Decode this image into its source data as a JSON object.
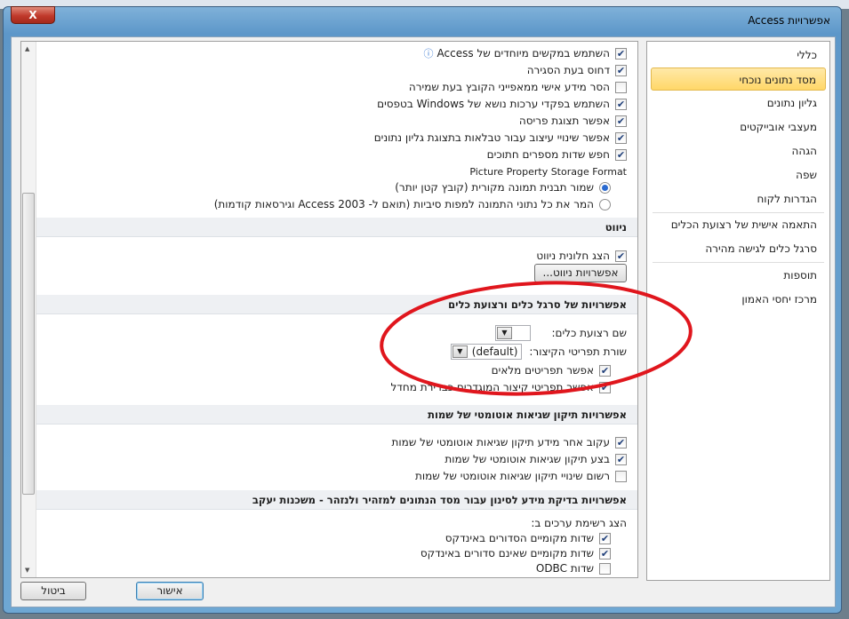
{
  "window": {
    "title": "אפשרויות Access",
    "close_label": "X"
  },
  "sidebar": {
    "items": [
      {
        "label": "כללי"
      },
      {
        "label": "מסד נתונים נוכחי"
      },
      {
        "label": "גליון נתונים"
      },
      {
        "label": "מעצבי אובייקטים"
      },
      {
        "label": "הגהה"
      },
      {
        "label": "שפה"
      },
      {
        "label": "הגדרות לקוח"
      },
      {
        "label": "התאמה אישית של רצועת הכלים"
      },
      {
        "label": "סרגל כלים לגישה מהירה"
      },
      {
        "label": "תוספות"
      },
      {
        "label": "מרכז יחסי האמון"
      }
    ],
    "selected": "מסד נתונים נוכחי"
  },
  "app_options": {
    "items": [
      {
        "label": "השתמש במקשים מיוחדים של Access",
        "checked": true
      },
      {
        "label": "דחוס בעת הסגירה",
        "checked": true
      },
      {
        "label": "הסר מידע אישי ממאפייני הקובץ בעת שמירה",
        "checked": false
      },
      {
        "label": "השתמש בפקדי ערכות נושא של Windows בטפסים",
        "checked": true
      },
      {
        "label": "אפשר תצוגת פריסה",
        "checked": true
      },
      {
        "label": "אפשר שינויי עיצוב עבור טבלאות בתצוגת גליון נתונים",
        "checked": true
      },
      {
        "label": "חפש שדות מספרים חתוכים",
        "checked": true
      }
    ],
    "picture_format_label": "Picture Property Storage Format",
    "radios": [
      {
        "label": "שמור תבנית תמונה מקורית (קובץ קטן יותר)",
        "selected": true
      },
      {
        "label": "המר את כל נתוני התמונה למפות סיביות (תואם ל- Access 2003 וגירסאות קודמות)",
        "selected": false
      }
    ]
  },
  "navigation": {
    "header": "ניווט",
    "show_pane": {
      "label": "הצג חלונית ניווט",
      "checked": true
    },
    "options_button": "אפשרויות ניווט..."
  },
  "ribbon": {
    "header": "אפשרויות של סרגל כלים ורצועת כלים",
    "ribbon_name_label": "שם רצועת כלים:",
    "ribbon_name_value": "",
    "shortcut_label": "שורת תפריטי הקיצור:",
    "shortcut_value": "(default)",
    "items": [
      {
        "label": "אפשר תפריטים מלאים",
        "checked": true
      },
      {
        "label": "אפשר תפריטי קיצור המוגדרים כברירת מחדל",
        "checked": true
      }
    ]
  },
  "autocorrect": {
    "header": "אפשרויות תיקון שגיאות אוטומטי של שמות",
    "items": [
      {
        "label": "עקוב אחר מידע תיקון שגיאות אוטומטי של שמות",
        "checked": true
      },
      {
        "label": "בצע תיקון שגיאות אוטומטי של שמות",
        "checked": true
      },
      {
        "label": "רשום שינויי תיקון שגיאות אוטומטי של שמות",
        "checked": false
      }
    ]
  },
  "filter": {
    "header": "אפשרויות בדיקת מידע לסינון עבור מסד הנתונים למזהיר ולנזהר - משכנות יעקב",
    "show_list_label": "הצג רשימת ערכים ב:",
    "items": [
      {
        "label": "שדות מקומיים הסדורים באינדקס",
        "checked": true
      },
      {
        "label": "שדות מקומיים שאינם סדורים באינדקס",
        "checked": true
      },
      {
        "label": "שדות ODBC",
        "checked": false
      }
    ]
  },
  "footer": {
    "ok": "אישור",
    "cancel": "ביטול"
  },
  "colors": {
    "annotation": "#e0161d",
    "selected_bg": "#ffd768"
  }
}
